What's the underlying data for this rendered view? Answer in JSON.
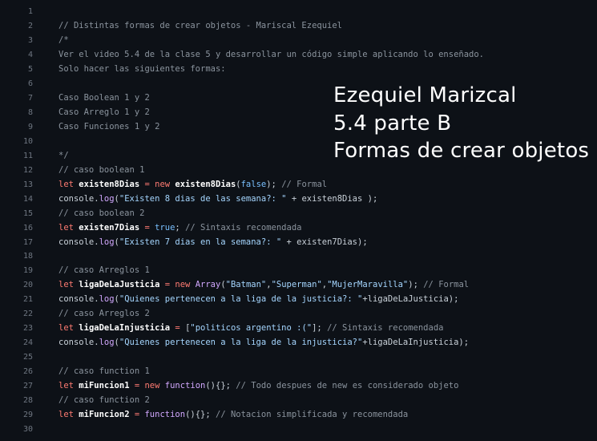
{
  "editor": {
    "lines": [
      {
        "num": "1",
        "tokens": []
      },
      {
        "num": "2",
        "tokens": [
          {
            "t": "comment",
            "v": "// Distintas formas de crear objetos - Mariscal Ezequiel"
          }
        ]
      },
      {
        "num": "3",
        "tokens": [
          {
            "t": "comment",
            "v": "/*"
          }
        ]
      },
      {
        "num": "4",
        "tokens": [
          {
            "t": "comment",
            "v": "Ver el video 5.4 de la clase 5 y desarrollar un código simple aplicando lo enseñado."
          }
        ]
      },
      {
        "num": "5",
        "tokens": [
          {
            "t": "comment",
            "v": "Solo hacer las siguientes formas:"
          }
        ]
      },
      {
        "num": "6",
        "tokens": []
      },
      {
        "num": "7",
        "tokens": [
          {
            "t": "comment",
            "v": "Caso Boolean 1 y 2"
          }
        ]
      },
      {
        "num": "8",
        "tokens": [
          {
            "t": "comment",
            "v": "Caso Arreglo 1 y 2"
          }
        ]
      },
      {
        "num": "9",
        "tokens": [
          {
            "t": "comment",
            "v": "Caso Funciones 1 y 2"
          }
        ]
      },
      {
        "num": "10",
        "tokens": []
      },
      {
        "num": "11",
        "tokens": [
          {
            "t": "comment",
            "v": "*/"
          }
        ]
      },
      {
        "num": "12",
        "tokens": [
          {
            "t": "comment",
            "v": "// caso boolean 1"
          }
        ]
      },
      {
        "num": "13",
        "tokens": [
          {
            "t": "kw",
            "v": "let "
          },
          {
            "t": "var",
            "v": "existen8Dias"
          },
          {
            "t": "kw",
            "v": " = new "
          },
          {
            "t": "var",
            "v": "existen8Dias"
          },
          {
            "t": "plain",
            "v": "("
          },
          {
            "t": "const",
            "v": "false"
          },
          {
            "t": "plain",
            "v": "); "
          },
          {
            "t": "comment",
            "v": "// Formal"
          }
        ]
      },
      {
        "num": "14",
        "tokens": [
          {
            "t": "plain",
            "v": "console."
          },
          {
            "t": "fn",
            "v": "log"
          },
          {
            "t": "plain",
            "v": "("
          },
          {
            "t": "str",
            "v": "\"Existen 8 dias de las semana?: \""
          },
          {
            "t": "plain",
            "v": " + existen8Dias );"
          }
        ]
      },
      {
        "num": "15",
        "tokens": [
          {
            "t": "comment",
            "v": "// caso boolean 2"
          }
        ]
      },
      {
        "num": "16",
        "tokens": [
          {
            "t": "kw",
            "v": "let "
          },
          {
            "t": "var",
            "v": "existen7Dias"
          },
          {
            "t": "kw",
            "v": " = "
          },
          {
            "t": "const",
            "v": "true"
          },
          {
            "t": "plain",
            "v": "; "
          },
          {
            "t": "comment",
            "v": "// Sintaxis recomendada"
          }
        ]
      },
      {
        "num": "17",
        "tokens": [
          {
            "t": "plain",
            "v": "console."
          },
          {
            "t": "fn",
            "v": "log"
          },
          {
            "t": "plain",
            "v": "("
          },
          {
            "t": "str",
            "v": "\"Existen 7 dias en la semana?: \""
          },
          {
            "t": "plain",
            "v": " + existen7Dias);"
          }
        ]
      },
      {
        "num": "18",
        "tokens": []
      },
      {
        "num": "19",
        "tokens": [
          {
            "t": "comment",
            "v": "// caso Arreglos 1"
          }
        ]
      },
      {
        "num": "20",
        "tokens": [
          {
            "t": "kw",
            "v": "let "
          },
          {
            "t": "var",
            "v": "ligaDeLaJusticia"
          },
          {
            "t": "kw",
            "v": " = new "
          },
          {
            "t": "fn",
            "v": "Array"
          },
          {
            "t": "plain",
            "v": "("
          },
          {
            "t": "str",
            "v": "\"Batman\""
          },
          {
            "t": "plain",
            "v": ","
          },
          {
            "t": "str",
            "v": "\"Superman\""
          },
          {
            "t": "plain",
            "v": ","
          },
          {
            "t": "str",
            "v": "\"MujerMaravilla\""
          },
          {
            "t": "plain",
            "v": "); "
          },
          {
            "t": "comment",
            "v": "// Formal"
          }
        ]
      },
      {
        "num": "21",
        "tokens": [
          {
            "t": "plain",
            "v": "console."
          },
          {
            "t": "fn",
            "v": "log"
          },
          {
            "t": "plain",
            "v": "("
          },
          {
            "t": "str",
            "v": "\"Quienes pertenecen a la liga de la justicia?: \""
          },
          {
            "t": "plain",
            "v": "+ligaDeLaJusticia);"
          }
        ]
      },
      {
        "num": "22",
        "tokens": [
          {
            "t": "comment",
            "v": "// caso Arreglos 2"
          }
        ]
      },
      {
        "num": "23",
        "tokens": [
          {
            "t": "kw",
            "v": "let "
          },
          {
            "t": "var",
            "v": "ligaDeLaInjusticia"
          },
          {
            "t": "kw",
            "v": " = "
          },
          {
            "t": "plain",
            "v": "["
          },
          {
            "t": "str",
            "v": "\"politicos argentino :(\""
          },
          {
            "t": "plain",
            "v": "]; "
          },
          {
            "t": "comment",
            "v": "// Sintaxis recomendada"
          }
        ]
      },
      {
        "num": "24",
        "tokens": [
          {
            "t": "plain",
            "v": "console."
          },
          {
            "t": "fn",
            "v": "log"
          },
          {
            "t": "plain",
            "v": "("
          },
          {
            "t": "str",
            "v": "\"Quienes pertenecen a la liga de la injusticia?\""
          },
          {
            "t": "plain",
            "v": "+ligaDeLaInjusticia);"
          }
        ]
      },
      {
        "num": "25",
        "tokens": []
      },
      {
        "num": "26",
        "tokens": [
          {
            "t": "comment",
            "v": "// caso function 1"
          }
        ]
      },
      {
        "num": "27",
        "tokens": [
          {
            "t": "kw",
            "v": "let "
          },
          {
            "t": "var",
            "v": "miFuncion1"
          },
          {
            "t": "kw",
            "v": " = new "
          },
          {
            "t": "fn",
            "v": "function"
          },
          {
            "t": "plain",
            "v": "(){}; "
          },
          {
            "t": "comment",
            "v": "// Todo despues de new es considerado objeto"
          }
        ]
      },
      {
        "num": "28",
        "tokens": [
          {
            "t": "comment",
            "v": "// caso function 2"
          }
        ]
      },
      {
        "num": "29",
        "tokens": [
          {
            "t": "kw",
            "v": "let "
          },
          {
            "t": "var",
            "v": "miFuncion2"
          },
          {
            "t": "kw",
            "v": " = "
          },
          {
            "t": "fn",
            "v": "function"
          },
          {
            "t": "plain",
            "v": "(){}; "
          },
          {
            "t": "comment",
            "v": "// Notacion simplificada y recomendada"
          }
        ]
      },
      {
        "num": "30",
        "tokens": []
      }
    ]
  },
  "overlay": {
    "line1": "Ezequiel Marizcal",
    "line2": "5.4 parte B",
    "line3": "Formas de crear objetos"
  },
  "colors": {
    "background": "#0d1117",
    "comment": "#8b949e",
    "keyword": "#ff7b72",
    "string": "#a5d6ff",
    "function": "#d2a8ff",
    "constant": "#79c0ff"
  }
}
